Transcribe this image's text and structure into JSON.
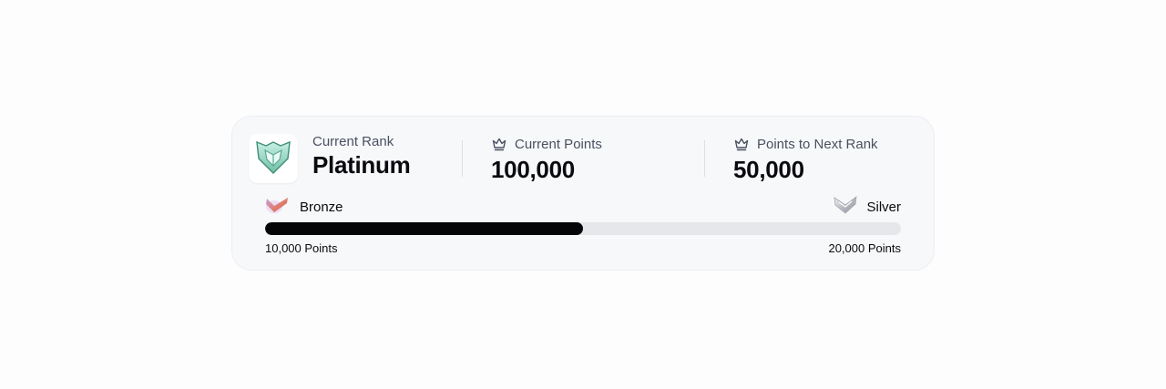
{
  "rank_card": {
    "current_rank": {
      "label": "Current Rank",
      "value": "Platinum",
      "icon": "platinum-shield-icon",
      "icon_color": "#8fd3bf"
    },
    "current_points": {
      "label": "Current Points",
      "value": "100,000",
      "icon": "crown-icon"
    },
    "points_to_next": {
      "label": "Points to Next Rank",
      "value": "50,000",
      "icon": "crown-icon"
    }
  },
  "progress": {
    "from_tier": {
      "label": "Bronze",
      "icon": "bronze-chevron-icon",
      "icon_color": "#d9736a"
    },
    "to_tier": {
      "label": "Silver",
      "icon": "silver-chevron-icon",
      "icon_color": "#b9bcc2"
    },
    "start_label": "10,000 Points",
    "end_label": "20,000 Points",
    "fraction": 0.5,
    "fill_color": "#050507",
    "track_color": "#e6e7eb"
  }
}
